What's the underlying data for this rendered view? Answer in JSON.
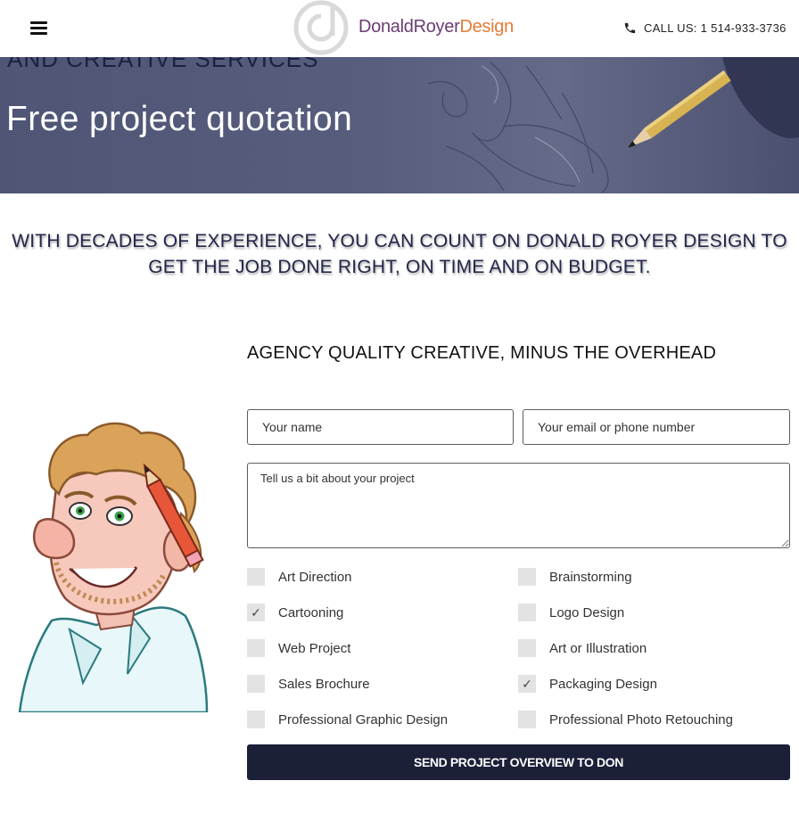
{
  "header": {
    "brand_part1": "DonaldRoyer",
    "brand_part2": "Design",
    "call_label": "CALL US: 1 514-933-3736",
    "icons": {
      "menu": "hamburger-icon",
      "phone": "phone-icon",
      "logo": "logo-mark-icon"
    }
  },
  "hero": {
    "cut_text": "AND CREATIVE SERVICES",
    "title": "Free project quotation"
  },
  "tagline": "WITH DECADES OF EXPERIENCE, YOU CAN COUNT ON DONALD ROYER DESIGN TO GET THE JOB DONE RIGHT, ON TIME AND ON BUDGET.",
  "form": {
    "heading": "AGENCY QUALITY CREATIVE, MINUS THE OVERHEAD",
    "name_placeholder": "Your name",
    "contact_placeholder": "Your email or phone number",
    "project_placeholder": "Tell us a bit about your project",
    "services_left": [
      {
        "label": "Art Direction",
        "checked": false
      },
      {
        "label": "Cartooning",
        "checked": true
      },
      {
        "label": "Web Project",
        "checked": false
      },
      {
        "label": "Sales Brochure",
        "checked": false
      },
      {
        "label": "Professional Graphic Design",
        "checked": false
      }
    ],
    "services_right": [
      {
        "label": "Brainstorming",
        "checked": false
      },
      {
        "label": "Logo Design",
        "checked": false
      },
      {
        "label": "Art or Illustration",
        "checked": false
      },
      {
        "label": "Packaging Design",
        "checked": true
      },
      {
        "label": "Professional Photo Retouching",
        "checked": false
      }
    ],
    "check_mark": "✓",
    "submit_label": "SEND PROJECT OVERVIEW TO DON"
  },
  "colors": {
    "button": "#1c1f38",
    "hero": "#575d7d",
    "brand_purple": "#6b3c73",
    "brand_orange": "#e37b35"
  }
}
